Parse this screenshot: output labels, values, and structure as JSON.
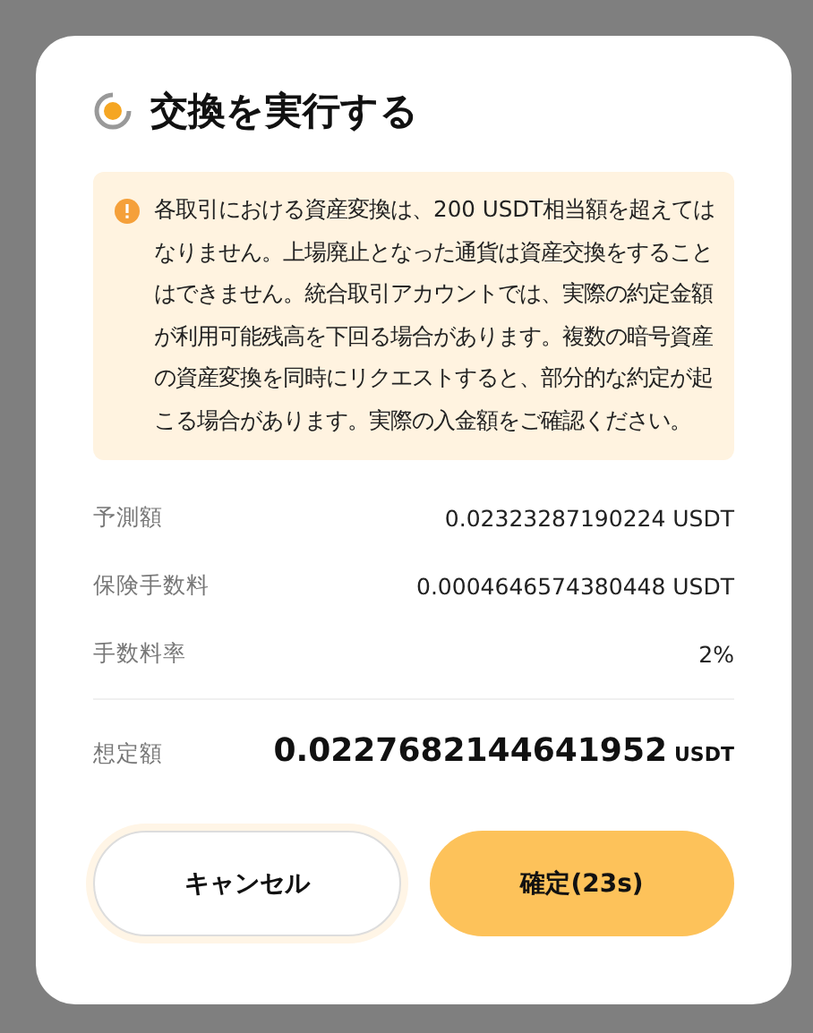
{
  "dialog": {
    "title": "交換を実行する",
    "notice": "各取引における資産変換は、200 USDT相当額を超えてはなりません。上場廃止となった通貨は資産交換をすることはできません。統合取引アカウントでは、実際の約定金額が利用可能残高を下回る場合があります。複数の暗号資産の資産変換を同時にリクエストすると、部分的な約定が起こる場合があります。実際の入金額をご確認ください。",
    "rows": [
      {
        "label": "予測額",
        "value": "0.02323287190224 USDT"
      },
      {
        "label": "保険手数料",
        "value": "0.0004646574380448 USDT"
      },
      {
        "label": "手数料率",
        "value": "2%"
      }
    ],
    "total": {
      "label": "想定額",
      "value": "0.0227682144641952",
      "unit": "USDT"
    },
    "buttons": [
      {
        "label": "キャンセル",
        "kind": "secondary"
      },
      {
        "label": "確定(23s)",
        "kind": "primary"
      }
    ]
  }
}
